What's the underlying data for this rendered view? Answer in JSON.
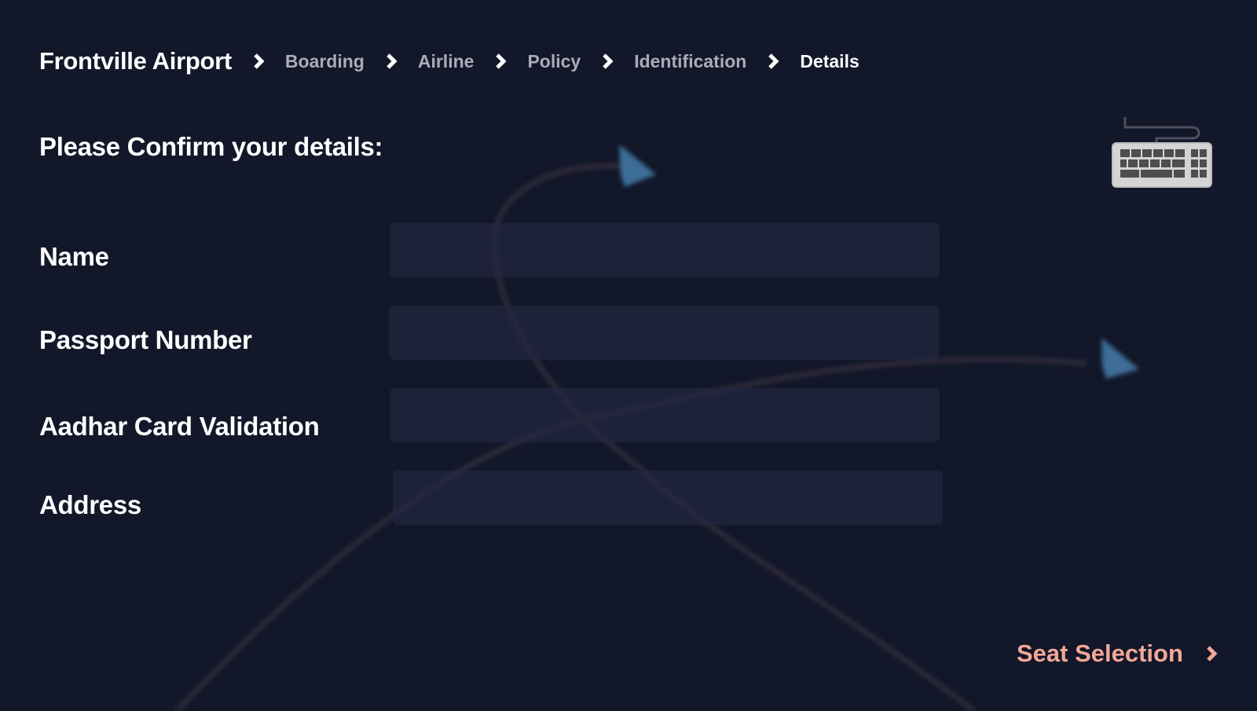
{
  "breadcrumb": {
    "root": "Frontville Airport",
    "items": [
      {
        "label": "Boarding"
      },
      {
        "label": "Airline"
      },
      {
        "label": "Policy"
      },
      {
        "label": "Identification"
      },
      {
        "label": "Details"
      }
    ]
  },
  "form": {
    "title": "Please Confirm your details:",
    "fields": [
      {
        "label": "Name",
        "value": "",
        "placeholder": ""
      },
      {
        "label": "Passport Number",
        "value": "",
        "placeholder": ""
      },
      {
        "label": "Aadhar Card Validation",
        "value": "",
        "placeholder": ""
      },
      {
        "label": "Address",
        "value": "",
        "placeholder": ""
      }
    ]
  },
  "toolbar": {
    "keyboard_icon": "keyboard-icon"
  },
  "footer": {
    "next_label": "Seat Selection",
    "next_icon": "chevron-right-icon"
  },
  "colors": {
    "background": "#121729",
    "input_background": "#1c2136",
    "accent": "#f2a897",
    "muted_text": "#a9adb8",
    "plane_icon": "#4a7fae"
  }
}
